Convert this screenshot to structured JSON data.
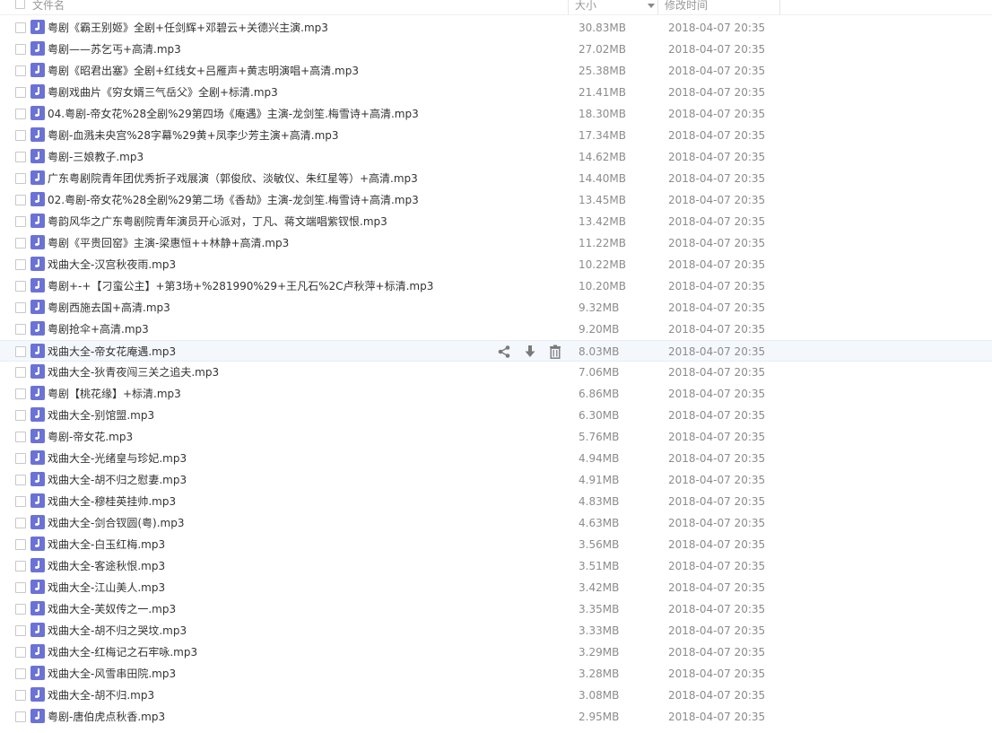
{
  "header": {
    "name_label": "文件名",
    "size_label": "大小",
    "time_label": "修改时间"
  },
  "colors": {
    "audio_icon": "#6b72d6",
    "hover_row": "#f4f8fd",
    "meta_text": "#8c8c8c"
  },
  "hover_actions": {
    "icons": [
      "share-icon",
      "download-icon",
      "delete-icon"
    ]
  },
  "files": [
    {
      "name": "粤剧《霸王别姬》全剧+任剑辉+邓碧云+关德兴主演.mp3",
      "size": "30.83MB",
      "time": "2018-04-07 20:35",
      "icon": "audio-icon"
    },
    {
      "name": "粤剧——苏乞丐+高清.mp3",
      "size": "27.02MB",
      "time": "2018-04-07 20:35",
      "icon": "audio-icon"
    },
    {
      "name": "粤剧《昭君出塞》全剧+红线女+吕雁声+黄志明演唱+高清.mp3",
      "size": "25.38MB",
      "time": "2018-04-07 20:35",
      "icon": "audio-icon"
    },
    {
      "name": "粤剧戏曲片《穷女婿三气岳父》全剧+标清.mp3",
      "size": "21.41MB",
      "time": "2018-04-07 20:35",
      "icon": "audio-icon"
    },
    {
      "name": "04.粤剧-帝女花%28全剧%29第四场《庵遇》主演-龙剑笙.梅雪诗+高清.mp3",
      "size": "18.30MB",
      "time": "2018-04-07 20:35",
      "icon": "audio-icon"
    },
    {
      "name": "粤剧-血溅未央宫%28字幕%29黄+凤李少芳主演+高清.mp3",
      "size": "17.34MB",
      "time": "2018-04-07 20:35",
      "icon": "audio-icon"
    },
    {
      "name": "粤剧-三娘教子.mp3",
      "size": "14.62MB",
      "time": "2018-04-07 20:35",
      "icon": "audio-icon"
    },
    {
      "name": "广东粤剧院青年团优秀折子戏展演（郭俊欣、淡敏仪、朱红星等）+高清.mp3",
      "size": "14.40MB",
      "time": "2018-04-07 20:35",
      "icon": "audio-icon"
    },
    {
      "name": "02.粤剧-帝女花%28全剧%29第二场《香劫》主演-龙剑笙.梅雪诗+高清.mp3",
      "size": "13.45MB",
      "time": "2018-04-07 20:35",
      "icon": "audio-icon"
    },
    {
      "name": "粤韵风华之广东粤剧院青年演员开心派对，丁凡、蒋文端唱紫钗恨.mp3",
      "size": "13.42MB",
      "time": "2018-04-07 20:35",
      "icon": "audio-icon"
    },
    {
      "name": "粤剧《平贵回窑》主演-梁惠恒++林静+高清.mp3",
      "size": "11.22MB",
      "time": "2018-04-07 20:35",
      "icon": "audio-icon"
    },
    {
      "name": "戏曲大全-汉宫秋夜雨.mp3",
      "size": "10.22MB",
      "time": "2018-04-07 20:35",
      "icon": "audio-icon"
    },
    {
      "name": "粤剧+-+【刁蛮公主】+第3场+%281990%29+王凡石%2C卢秋萍+标清.mp3",
      "size": "10.20MB",
      "time": "2018-04-07 20:35",
      "icon": "audio-icon"
    },
    {
      "name": "粤剧西施去国+高清.mp3",
      "size": "9.32MB",
      "time": "2018-04-07 20:35",
      "icon": "audio-icon"
    },
    {
      "name": "粤剧抢伞+高清.mp3",
      "size": "9.20MB",
      "time": "2018-04-07 20:35",
      "icon": "audio-icon"
    },
    {
      "name": "戏曲大全-帝女花庵遇.mp3",
      "size": "8.03MB",
      "time": "2018-04-07 20:35",
      "icon": "audio-icon",
      "hovered": true
    },
    {
      "name": "戏曲大全-狄青夜闯三关之追夫.mp3",
      "size": "7.06MB",
      "time": "2018-04-07 20:35",
      "icon": "audio-icon"
    },
    {
      "name": "粤剧【桃花缘】+标清.mp3",
      "size": "6.86MB",
      "time": "2018-04-07 20:35",
      "icon": "audio-icon"
    },
    {
      "name": "戏曲大全-别馆盟.mp3",
      "size": "6.30MB",
      "time": "2018-04-07 20:35",
      "icon": "audio-icon"
    },
    {
      "name": "粤剧-帝女花.mp3",
      "size": "5.76MB",
      "time": "2018-04-07 20:35",
      "icon": "audio-icon"
    },
    {
      "name": "戏曲大全-光绪皇与珍妃.mp3",
      "size": "4.94MB",
      "time": "2018-04-07 20:35",
      "icon": "audio-icon"
    },
    {
      "name": "戏曲大全-胡不归之慰妻.mp3",
      "size": "4.91MB",
      "time": "2018-04-07 20:35",
      "icon": "audio-icon"
    },
    {
      "name": "戏曲大全-穆桂英挂帅.mp3",
      "size": "4.83MB",
      "time": "2018-04-07 20:35",
      "icon": "audio-icon"
    },
    {
      "name": "戏曲大全-剑合钗圆(粤).mp3",
      "size": "4.63MB",
      "time": "2018-04-07 20:35",
      "icon": "audio-icon"
    },
    {
      "name": "戏曲大全-白玉红梅.mp3",
      "size": "3.56MB",
      "time": "2018-04-07 20:35",
      "icon": "audio-icon"
    },
    {
      "name": "戏曲大全-客途秋恨.mp3",
      "size": "3.51MB",
      "time": "2018-04-07 20:35",
      "icon": "audio-icon"
    },
    {
      "name": "戏曲大全-江山美人.mp3",
      "size": "3.42MB",
      "time": "2018-04-07 20:35",
      "icon": "audio-icon"
    },
    {
      "name": "戏曲大全-芙奴传之一.mp3",
      "size": "3.35MB",
      "time": "2018-04-07 20:35",
      "icon": "audio-icon"
    },
    {
      "name": "戏曲大全-胡不归之哭坟.mp3",
      "size": "3.33MB",
      "time": "2018-04-07 20:35",
      "icon": "audio-icon"
    },
    {
      "name": "戏曲大全-红梅记之石牢咏.mp3",
      "size": "3.29MB",
      "time": "2018-04-07 20:35",
      "icon": "audio-icon"
    },
    {
      "name": "戏曲大全-风雪串田院.mp3",
      "size": "3.28MB",
      "time": "2018-04-07 20:35",
      "icon": "audio-icon"
    },
    {
      "name": "戏曲大全-胡不归.mp3",
      "size": "3.08MB",
      "time": "2018-04-07 20:35",
      "icon": "audio-icon"
    },
    {
      "name": "粤剧-唐伯虎点秋香.mp3",
      "size": "2.95MB",
      "time": "2018-04-07 20:35",
      "icon": "audio-icon"
    }
  ]
}
